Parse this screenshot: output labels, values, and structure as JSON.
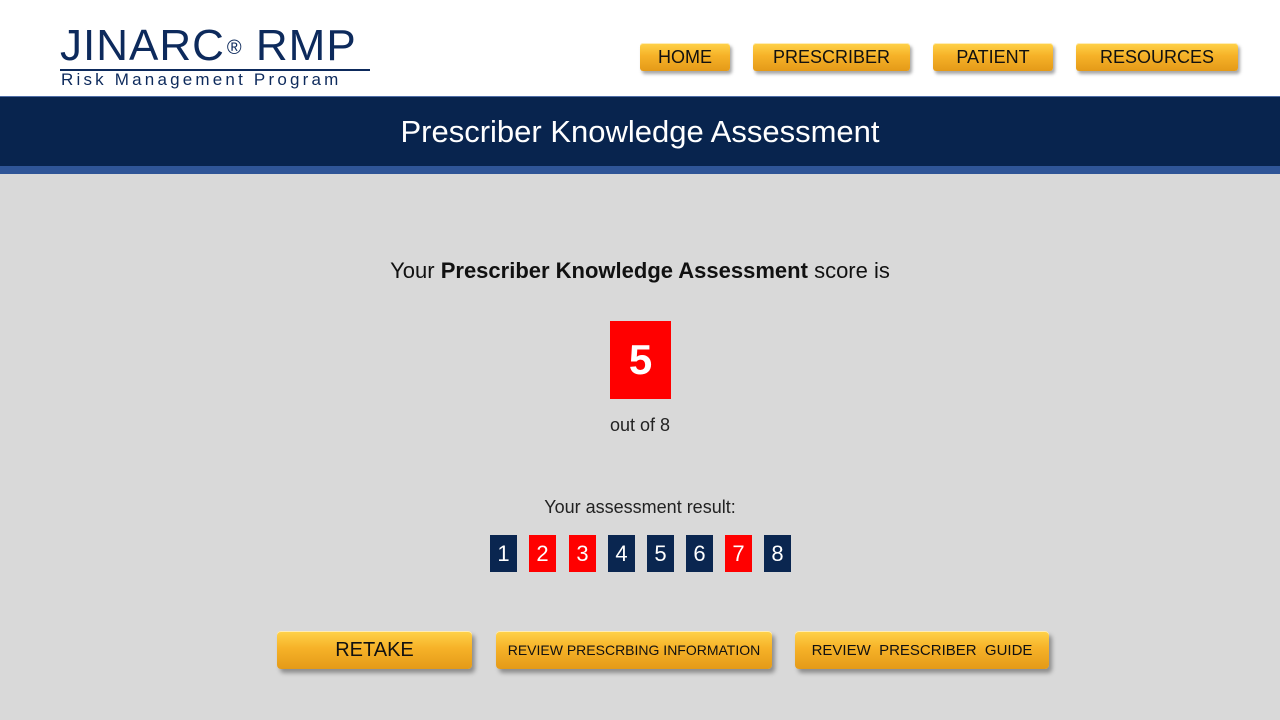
{
  "logo": {
    "name": "JINARC",
    "registered": "®",
    "suffix": "RMP",
    "subtitle": "Risk Management Program"
  },
  "nav": {
    "items": [
      {
        "label": "HOME"
      },
      {
        "label": "PRESCRIBER"
      },
      {
        "label": "PATIENT"
      },
      {
        "label": "RESOURCES"
      }
    ]
  },
  "banner": {
    "title": "Prescriber Knowledge Assessment"
  },
  "score": {
    "prefix": "Your",
    "emphasis": "Prescriber Knowledge Assessment",
    "suffix": "score is",
    "value": "5",
    "out_of": "out of 8",
    "correct": 5,
    "total": 8
  },
  "result": {
    "label": "Your assessment result:",
    "questions": [
      {
        "number": "1",
        "status": "correct",
        "color": "#0a2650"
      },
      {
        "number": "2",
        "status": "incorrect",
        "color": "#ff0000"
      },
      {
        "number": "3",
        "status": "incorrect",
        "color": "#ff0000"
      },
      {
        "number": "4",
        "status": "correct",
        "color": "#0a2650"
      },
      {
        "number": "5",
        "status": "correct",
        "color": "#0a2650"
      },
      {
        "number": "6",
        "status": "correct",
        "color": "#0a2650"
      },
      {
        "number": "7",
        "status": "incorrect",
        "color": "#ff0000"
      },
      {
        "number": "8",
        "status": "correct",
        "color": "#0a2650"
      }
    ]
  },
  "actions": {
    "retake": "RETAKE",
    "review_pi": "REVIEW PRESCRBING INFORMATION",
    "review_guide": "REVIEW  PRESCRIBER  GUIDE"
  },
  "colors": {
    "navy": "#08244e",
    "stripe": "#2f5597",
    "gold": "#f6b228",
    "red": "#ff0000"
  }
}
